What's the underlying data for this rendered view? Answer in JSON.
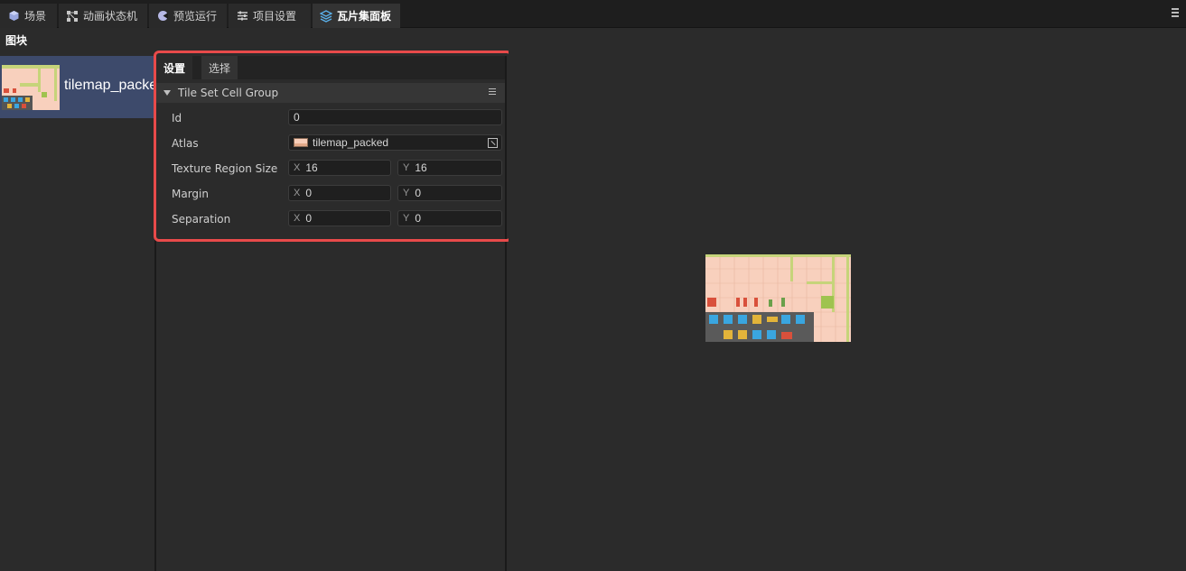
{
  "tabs": [
    {
      "label": "场景",
      "icon": "scene-icon"
    },
    {
      "label": "动画状态机",
      "icon": "state-machine-icon"
    },
    {
      "label": "预览运行",
      "icon": "preview-icon"
    },
    {
      "label": "项目设置",
      "icon": "settings-sliders-icon"
    },
    {
      "label": "瓦片集面板",
      "icon": "tileset-layers-icon",
      "active": true
    }
  ],
  "left_panel": {
    "title": "图块",
    "cells": [
      {
        "label": "tilemap_packed"
      }
    ]
  },
  "inspector": {
    "tabs": {
      "settings": "设置",
      "select": "选择"
    },
    "group_title": "Tile Set Cell Group",
    "properties": {
      "id": {
        "label": "Id",
        "value": "0"
      },
      "atlas": {
        "label": "Atlas",
        "value": "tilemap_packed"
      },
      "texture_region_size": {
        "label": "Texture Region Size",
        "x_axis": "X",
        "x": "16",
        "y_axis": "Y",
        "y": "16"
      },
      "margin": {
        "label": "Margin",
        "x_axis": "X",
        "x": "0",
        "y_axis": "Y",
        "y": "0"
      },
      "separation": {
        "label": "Separation",
        "x_axis": "X",
        "x": "0",
        "y_axis": "Y",
        "y": "0"
      }
    }
  },
  "colors": {
    "highlight": "#e84a4a",
    "selected_row": "#3d4a6b",
    "background": "#2b2b2b",
    "tabbar": "#1e1e1e"
  }
}
